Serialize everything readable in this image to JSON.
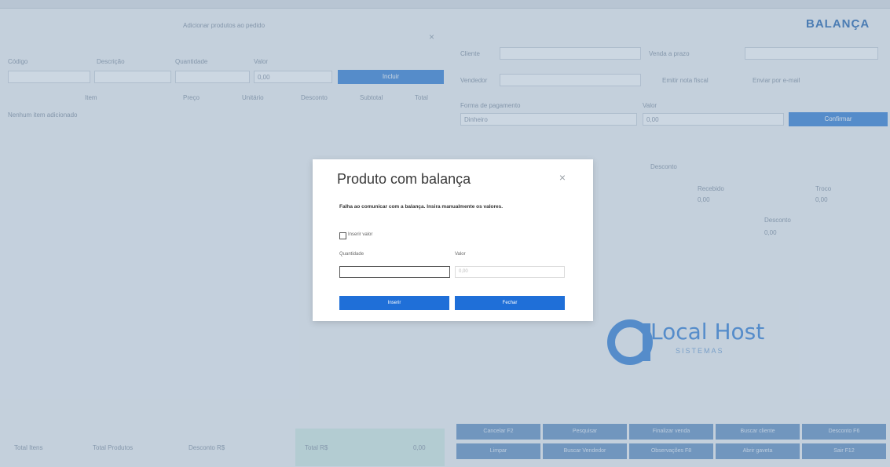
{
  "background": {
    "left_panel": {
      "header_text": "Adicionar produtos ao pedido",
      "field_labels": [
        "Código",
        "Descrição",
        "Quantidade",
        "Valor"
      ],
      "field_values": [
        "",
        "",
        "",
        "0,00"
      ],
      "add_button": "Incluir",
      "table_headers": [
        "Item",
        "Preço",
        "Unitário",
        "Desconto",
        "Subtotal",
        "Total"
      ],
      "empty_text": "Nenhum item adicionado",
      "footer_labels": [
        "Total Itens",
        "Total Produtos",
        "Desconto R$"
      ],
      "footer_total_label": "Total R$",
      "footer_total_value": "0,00"
    },
    "right_panel": {
      "brand_text": "BALANÇA",
      "customer_label": "Cliente",
      "seller_label": "Vendedor",
      "payment_label": "Forma de pagamento",
      "payment_value": "Dinheiro",
      "value_label": "Valor",
      "value_input": "0,00",
      "confirm_button": "Confirmar",
      "discount_label": "Desconto",
      "discount_value": "0,00",
      "received_label": "Recebido",
      "received_value": "0,00",
      "change_label": "Troco",
      "change_value": "0,00",
      "checkbox_labels": [
        "Venda a prazo",
        "Emitir nota fiscal",
        "Enviar por e-mail"
      ],
      "grid_buttons": [
        "Cancelar F2",
        "Pesquisar",
        "Finalizar venda",
        "Buscar cliente",
        "Desconto F6",
        "Limpar",
        "Buscar Vendedor",
        "Observações F8",
        "Abrir gaveta",
        "Sair F12"
      ],
      "logo_main": "Local Host",
      "logo_sub": "SISTEMAS"
    }
  },
  "modal": {
    "title": "Produto com balança",
    "close_glyph": "×",
    "message": "Falha ao comunicar com a balança. Insira manualmente os valores.",
    "checkbox_label": "Inserir valor",
    "quantity_label": "Quantidade",
    "quantity_value": "",
    "value_label": "Valor",
    "value_placeholder": "0,00",
    "insert_button": "Inserir",
    "close_button": "Fechar"
  },
  "colors": {
    "overlay": "#7896b4",
    "primary_button": "#1f6fd8",
    "bg_blue": "#3f86d8"
  }
}
